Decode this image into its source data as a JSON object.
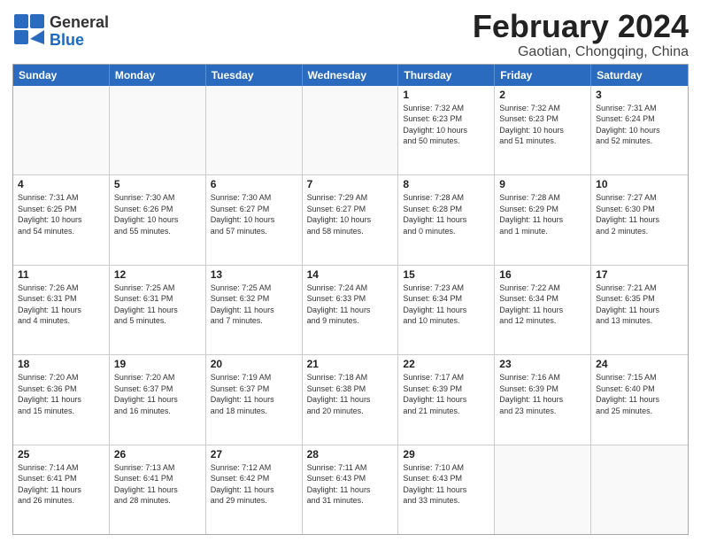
{
  "header": {
    "logo": {
      "line1": "General",
      "line2": "Blue"
    },
    "title": "February 2024",
    "subtitle": "Gaotian, Chongqing, China"
  },
  "days_of_week": [
    "Sunday",
    "Monday",
    "Tuesday",
    "Wednesday",
    "Thursday",
    "Friday",
    "Saturday"
  ],
  "weeks": [
    [
      {
        "day": "",
        "info": ""
      },
      {
        "day": "",
        "info": ""
      },
      {
        "day": "",
        "info": ""
      },
      {
        "day": "",
        "info": ""
      },
      {
        "day": "1",
        "info": "Sunrise: 7:32 AM\nSunset: 6:23 PM\nDaylight: 10 hours\nand 50 minutes."
      },
      {
        "day": "2",
        "info": "Sunrise: 7:32 AM\nSunset: 6:23 PM\nDaylight: 10 hours\nand 51 minutes."
      },
      {
        "day": "3",
        "info": "Sunrise: 7:31 AM\nSunset: 6:24 PM\nDaylight: 10 hours\nand 52 minutes."
      }
    ],
    [
      {
        "day": "4",
        "info": "Sunrise: 7:31 AM\nSunset: 6:25 PM\nDaylight: 10 hours\nand 54 minutes."
      },
      {
        "day": "5",
        "info": "Sunrise: 7:30 AM\nSunset: 6:26 PM\nDaylight: 10 hours\nand 55 minutes."
      },
      {
        "day": "6",
        "info": "Sunrise: 7:30 AM\nSunset: 6:27 PM\nDaylight: 10 hours\nand 57 minutes."
      },
      {
        "day": "7",
        "info": "Sunrise: 7:29 AM\nSunset: 6:27 PM\nDaylight: 10 hours\nand 58 minutes."
      },
      {
        "day": "8",
        "info": "Sunrise: 7:28 AM\nSunset: 6:28 PM\nDaylight: 11 hours\nand 0 minutes."
      },
      {
        "day": "9",
        "info": "Sunrise: 7:28 AM\nSunset: 6:29 PM\nDaylight: 11 hours\nand 1 minute."
      },
      {
        "day": "10",
        "info": "Sunrise: 7:27 AM\nSunset: 6:30 PM\nDaylight: 11 hours\nand 2 minutes."
      }
    ],
    [
      {
        "day": "11",
        "info": "Sunrise: 7:26 AM\nSunset: 6:31 PM\nDaylight: 11 hours\nand 4 minutes."
      },
      {
        "day": "12",
        "info": "Sunrise: 7:25 AM\nSunset: 6:31 PM\nDaylight: 11 hours\nand 5 minutes."
      },
      {
        "day": "13",
        "info": "Sunrise: 7:25 AM\nSunset: 6:32 PM\nDaylight: 11 hours\nand 7 minutes."
      },
      {
        "day": "14",
        "info": "Sunrise: 7:24 AM\nSunset: 6:33 PM\nDaylight: 11 hours\nand 9 minutes."
      },
      {
        "day": "15",
        "info": "Sunrise: 7:23 AM\nSunset: 6:34 PM\nDaylight: 11 hours\nand 10 minutes."
      },
      {
        "day": "16",
        "info": "Sunrise: 7:22 AM\nSunset: 6:34 PM\nDaylight: 11 hours\nand 12 minutes."
      },
      {
        "day": "17",
        "info": "Sunrise: 7:21 AM\nSunset: 6:35 PM\nDaylight: 11 hours\nand 13 minutes."
      }
    ],
    [
      {
        "day": "18",
        "info": "Sunrise: 7:20 AM\nSunset: 6:36 PM\nDaylight: 11 hours\nand 15 minutes."
      },
      {
        "day": "19",
        "info": "Sunrise: 7:20 AM\nSunset: 6:37 PM\nDaylight: 11 hours\nand 16 minutes."
      },
      {
        "day": "20",
        "info": "Sunrise: 7:19 AM\nSunset: 6:37 PM\nDaylight: 11 hours\nand 18 minutes."
      },
      {
        "day": "21",
        "info": "Sunrise: 7:18 AM\nSunset: 6:38 PM\nDaylight: 11 hours\nand 20 minutes."
      },
      {
        "day": "22",
        "info": "Sunrise: 7:17 AM\nSunset: 6:39 PM\nDaylight: 11 hours\nand 21 minutes."
      },
      {
        "day": "23",
        "info": "Sunrise: 7:16 AM\nSunset: 6:39 PM\nDaylight: 11 hours\nand 23 minutes."
      },
      {
        "day": "24",
        "info": "Sunrise: 7:15 AM\nSunset: 6:40 PM\nDaylight: 11 hours\nand 25 minutes."
      }
    ],
    [
      {
        "day": "25",
        "info": "Sunrise: 7:14 AM\nSunset: 6:41 PM\nDaylight: 11 hours\nand 26 minutes."
      },
      {
        "day": "26",
        "info": "Sunrise: 7:13 AM\nSunset: 6:41 PM\nDaylight: 11 hours\nand 28 minutes."
      },
      {
        "day": "27",
        "info": "Sunrise: 7:12 AM\nSunset: 6:42 PM\nDaylight: 11 hours\nand 29 minutes."
      },
      {
        "day": "28",
        "info": "Sunrise: 7:11 AM\nSunset: 6:43 PM\nDaylight: 11 hours\nand 31 minutes."
      },
      {
        "day": "29",
        "info": "Sunrise: 7:10 AM\nSunset: 6:43 PM\nDaylight: 11 hours\nand 33 minutes."
      },
      {
        "day": "",
        "info": ""
      },
      {
        "day": "",
        "info": ""
      }
    ]
  ]
}
